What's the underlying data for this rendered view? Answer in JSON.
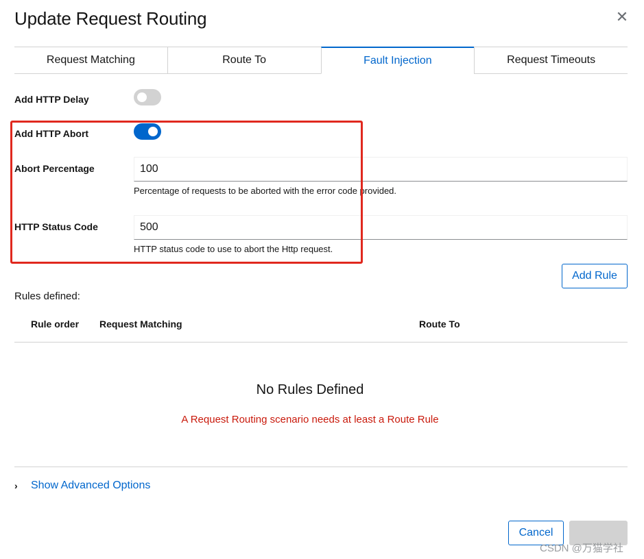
{
  "dialog": {
    "title": "Update Request Routing"
  },
  "tabs": [
    {
      "label": "Request Matching",
      "active": false
    },
    {
      "label": "Route To",
      "active": false
    },
    {
      "label": "Fault Injection",
      "active": true
    },
    {
      "label": "Request Timeouts",
      "active": false
    }
  ],
  "fault": {
    "delay_label": "Add HTTP Delay",
    "delay_on": false,
    "abort_label": "Add HTTP Abort",
    "abort_on": true,
    "percentage_label": "Abort Percentage",
    "percentage_value": "100",
    "percentage_help": "Percentage of requests to be aborted with the error code provided.",
    "status_label": "HTTP Status Code",
    "status_value": "500",
    "status_help": "HTTP status code to use to abort the Http request."
  },
  "rules": {
    "add_button": "Add Rule",
    "defined_label": "Rules defined:",
    "columns": [
      "Rule order",
      "Request Matching",
      "Route To"
    ],
    "empty_title": "No Rules Defined",
    "empty_message": "A Request Routing scenario needs at least a Route Rule"
  },
  "advanced": {
    "label": "Show Advanced Options"
  },
  "footer": {
    "cancel_label": "Cancel",
    "watermark": "CSDN @万猫学社"
  },
  "colors": {
    "accent": "#0066cc",
    "error": "#c9190b",
    "highlight_box": "#e0281e"
  },
  "icons": {
    "close": "close-icon",
    "advanced": "chevron-right-icon"
  }
}
